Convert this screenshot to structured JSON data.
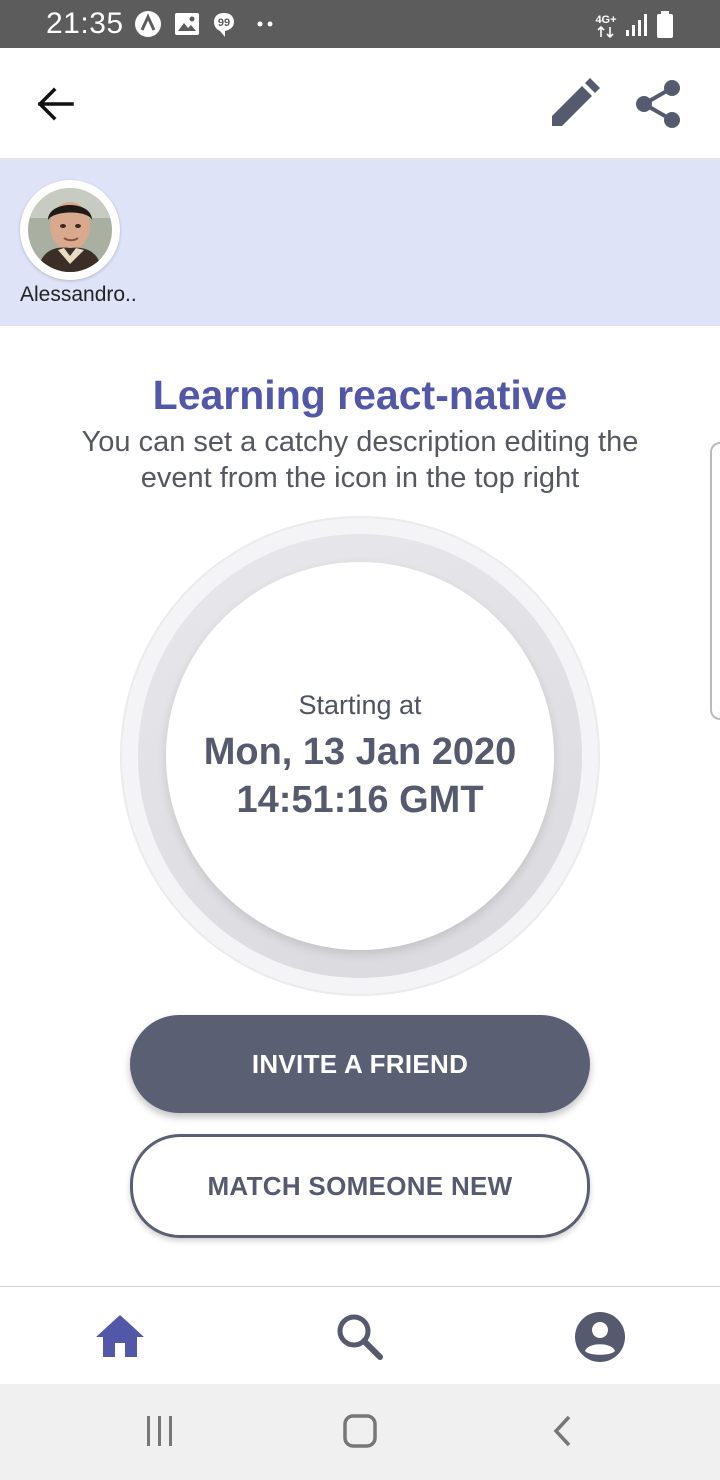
{
  "status_bar": {
    "time": "21:35",
    "left_icons": [
      "app-a-icon",
      "image-icon",
      "message-icon",
      "more-dots-icon"
    ],
    "network": "4G+",
    "right_icons": [
      "network-4g-icon",
      "signal-icon",
      "battery-icon"
    ]
  },
  "app_bar": {
    "back_icon": "arrow-left-icon",
    "edit_icon": "pencil-icon",
    "share_icon": "share-icon"
  },
  "participants": [
    {
      "name": "Alessandro.."
    }
  ],
  "event": {
    "title": "Learning react-native",
    "description": "You can set a catchy description editing the event from the icon in the top right",
    "starting_label": "Starting at",
    "starting_date": "Mon, 13 Jan 2020",
    "starting_time": "14:51:16 GMT"
  },
  "actions": {
    "invite_label": "INVITE A FRIEND",
    "match_label": "MATCH SOMEONE NEW"
  },
  "bottom_nav": {
    "items": [
      {
        "icon": "home-icon",
        "active": true
      },
      {
        "icon": "search-icon",
        "active": false
      },
      {
        "icon": "account-icon",
        "active": false
      }
    ]
  },
  "colors": {
    "accent": "#5257a8",
    "primary_button": "#5b5f73",
    "participants_bg": "#dfe3f8",
    "icon_dark": "#555a6e"
  }
}
